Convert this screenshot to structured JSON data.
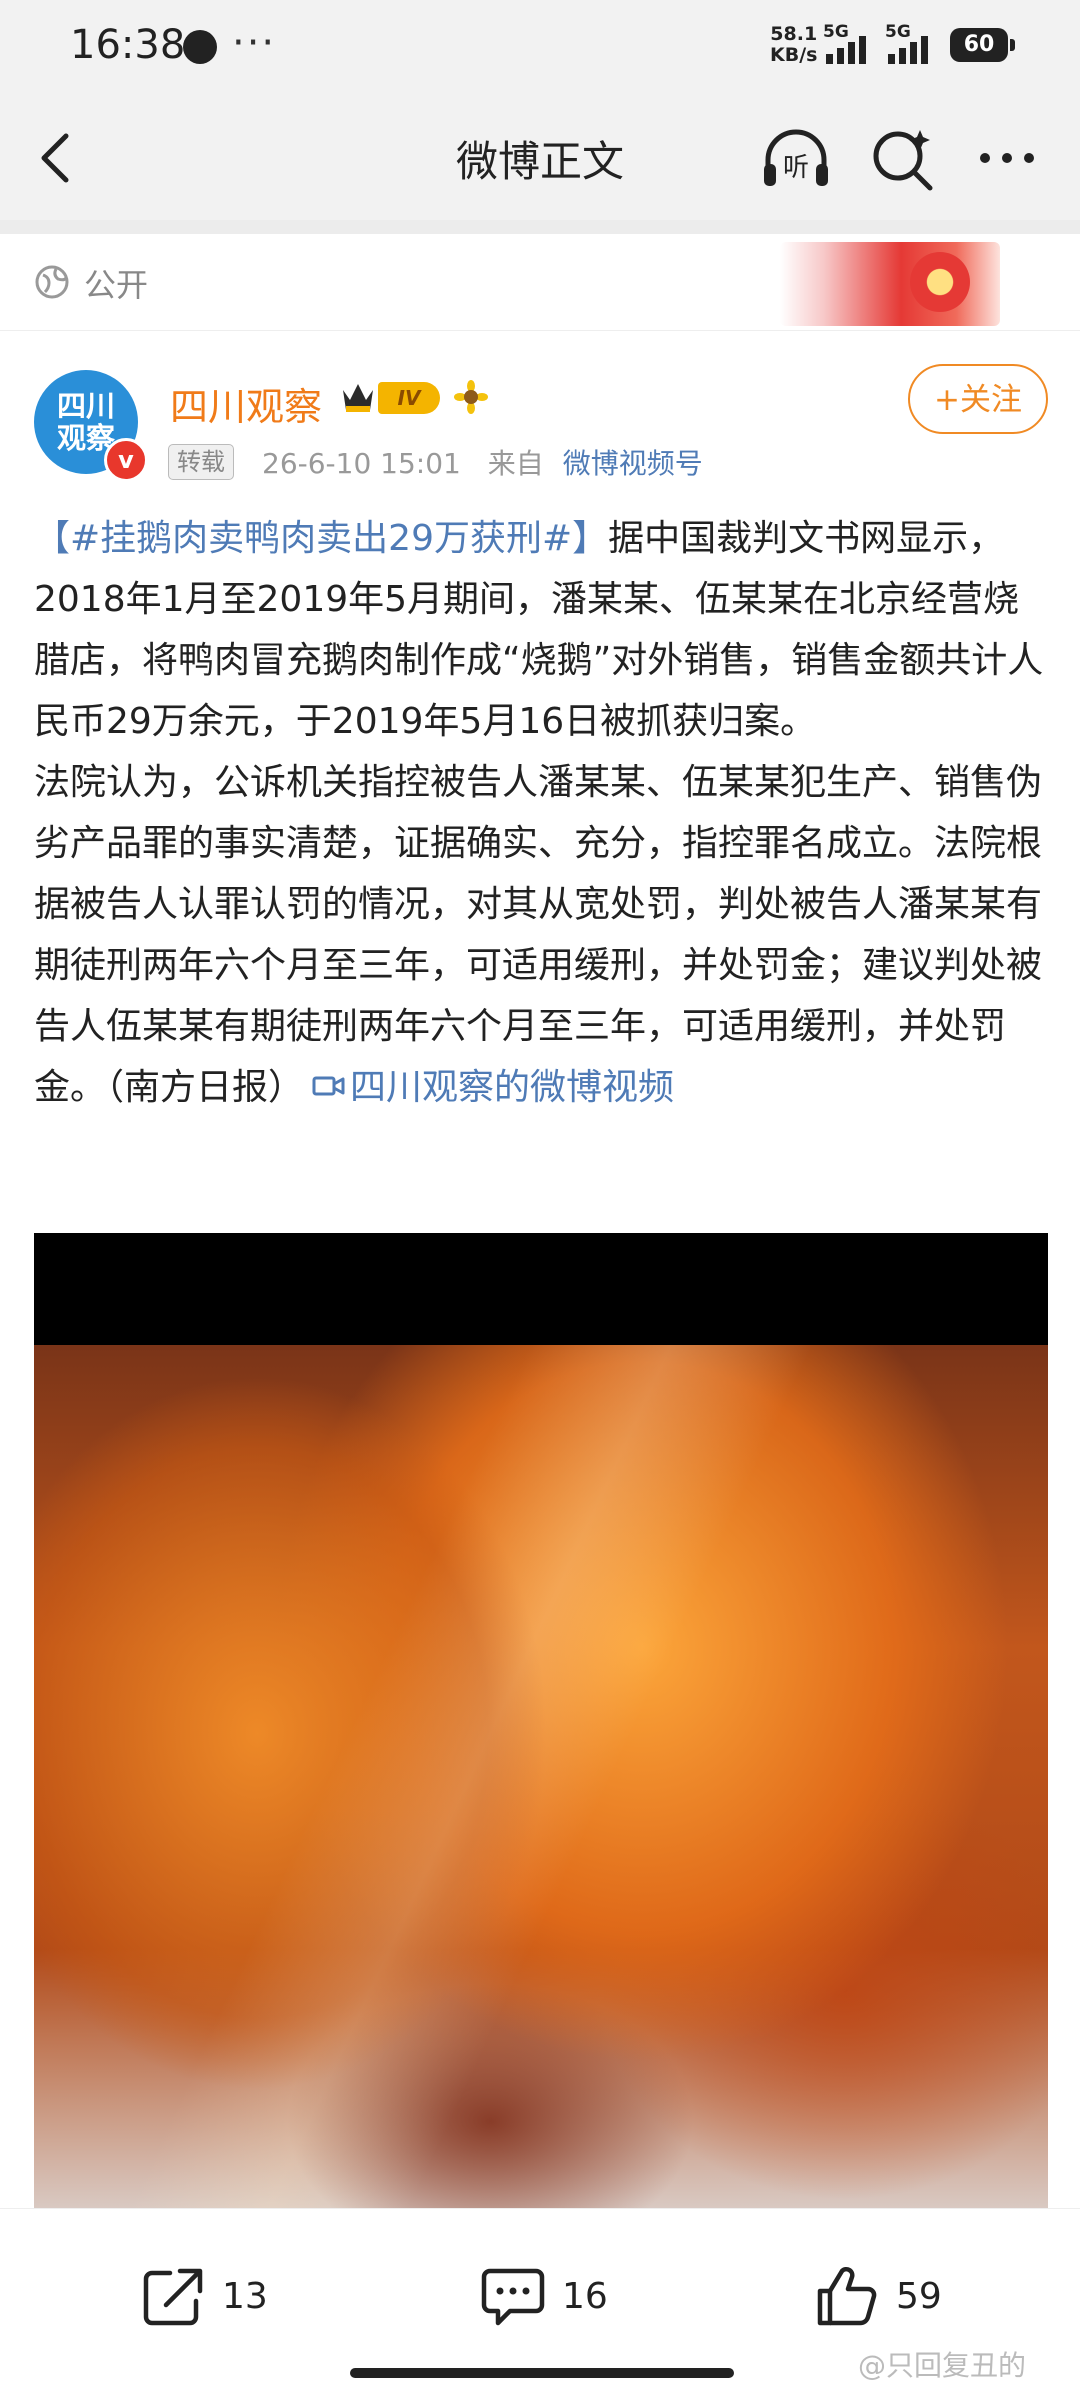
{
  "status_bar": {
    "time": "16:38",
    "dots": "···",
    "speed_value": "58.1",
    "speed_unit": "KB/s",
    "network1": "5G",
    "network2": "5G",
    "battery": "60"
  },
  "header": {
    "title": "微博正文",
    "icons": [
      "back-icon",
      "listen-icon",
      "search-icon",
      "more-icon"
    ]
  },
  "visibility": {
    "label": "公开",
    "icon": "globe-icon"
  },
  "post": {
    "author": {
      "name": "四川观察",
      "avatar_text_line1": "四川",
      "avatar_text_line2": "观察",
      "verified_mark": "v",
      "level": "IV"
    },
    "follow_label": "+关注",
    "repost_tag": "转载",
    "timestamp": "26-6-10 15:01",
    "source_prefix": "来自",
    "source": "微博视频号",
    "topic": "【#挂鹅肉卖鸭肉卖出29万获刑#】",
    "paragraph1": "据中国裁判文书网显示，2018年1月至2019年5月期间，潘某某、伍某某在北京经营烧腊店，将鸭肉冒充鹅肉制作成“烧鹅”对外销售，销售金额共计人民币29万余元，于2019年5月16日被抓获归案。",
    "paragraph2": "法院认为，公诉机关指控被告人潘某某、伍某某犯生产、销售伪劣产品罪的事实清楚，证据确实、充分，指控罪名成立。法院根据被告人认罪认罚的情况，对其从宽处罚，判处被告人潘某某有期徒刑两年六个月至三年，可适用缓刑，并处罚金；建议判处被告人伍某某有期徒刑两年六个月至三年，可适用缓刑，并处罚金。（南方日报）",
    "video_link": "四川观察的微博视频"
  },
  "actions": {
    "share_count": "13",
    "comment_count": "16",
    "like_count": "59"
  },
  "watermark": "@只回复丑的",
  "colors": {
    "accent_orange": "#f07b19",
    "link_blue": "#4f7bb6",
    "verified_red": "#e8372c"
  }
}
